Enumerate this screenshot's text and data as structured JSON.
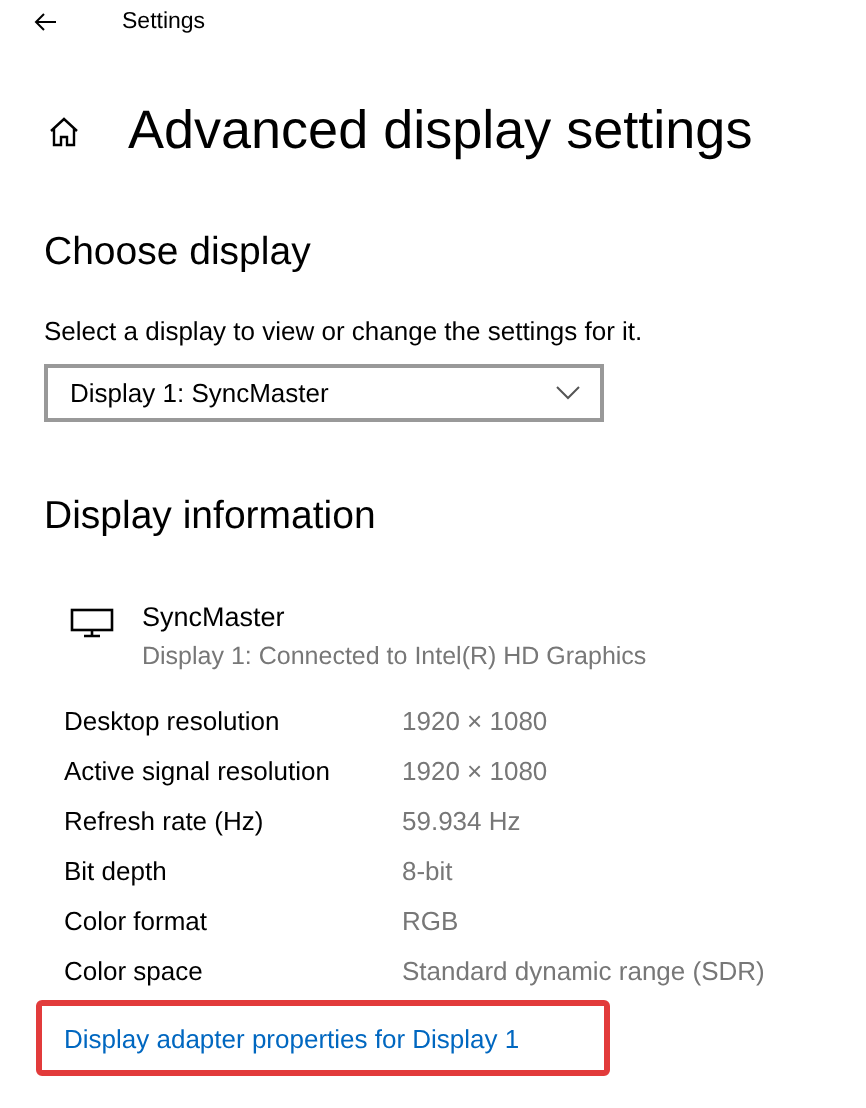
{
  "window": {
    "title": "Settings"
  },
  "page_title": "Advanced display settings",
  "choose_display": {
    "heading": "Choose display",
    "description": "Select a display to view or change the settings for it.",
    "dropdown": {
      "value": "Display 1: SyncMaster"
    }
  },
  "display_information": {
    "heading": "Display information",
    "monitor": {
      "name": "SyncMaster",
      "subtitle": "Display 1: Connected to Intel(R) HD Graphics"
    },
    "rows": [
      {
        "label": "Desktop resolution",
        "value": "1920 × 1080"
      },
      {
        "label": "Active signal resolution",
        "value": "1920 × 1080"
      },
      {
        "label": "Refresh rate (Hz)",
        "value": "59.934 Hz"
      },
      {
        "label": "Bit depth",
        "value": "8-bit"
      },
      {
        "label": "Color format",
        "value": "RGB"
      },
      {
        "label": "Color space",
        "value": "Standard dynamic range (SDR)"
      }
    ]
  },
  "adapter_link": {
    "text": "Display adapter properties for Display 1",
    "highlighted": true
  }
}
